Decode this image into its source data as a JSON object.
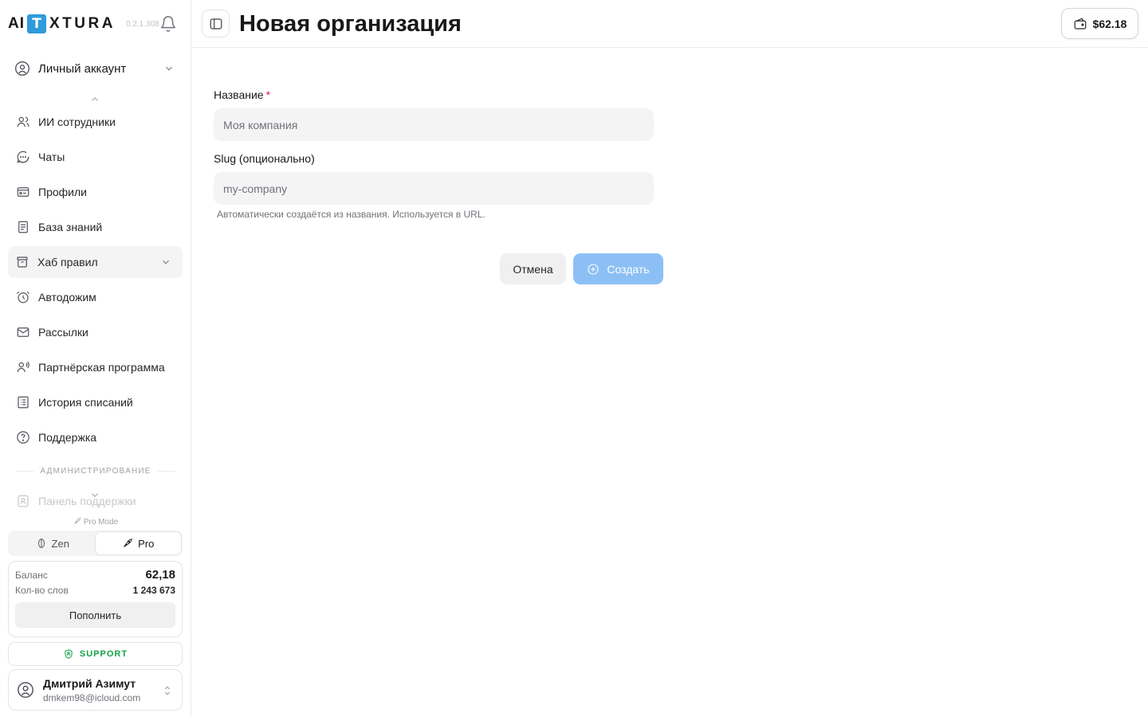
{
  "brand": {
    "prefix": "AI",
    "logo_letter": "T",
    "suffix": "XTURA",
    "version": "0.2.1.308"
  },
  "account": {
    "label": "Личный аккаунт"
  },
  "nav": [
    {
      "label": "ИИ сотрудники",
      "icon": "users-icon"
    },
    {
      "label": "Чаты",
      "icon": "chat-icon"
    },
    {
      "label": "Профили",
      "icon": "profile-card-icon"
    },
    {
      "label": "База знаний",
      "icon": "document-icon"
    },
    {
      "label": "Хаб правил",
      "icon": "rules-hub-icon"
    },
    {
      "label": "Автодожим",
      "icon": "alarm-clock-icon"
    },
    {
      "label": "Рассылки",
      "icon": "mail-icon"
    },
    {
      "label": "Партнёрская программа",
      "icon": "partner-icon"
    },
    {
      "label": "История списаний",
      "icon": "history-list-icon"
    },
    {
      "label": "Поддержка",
      "icon": "help-icon"
    }
  ],
  "admin": {
    "section": "АДМИНИСТРИРОВАНИЕ",
    "item": "Панель поддержки"
  },
  "mode": {
    "caption": "Pro Mode",
    "zen": "Zen",
    "pro": "Pro",
    "selected": "Pro"
  },
  "balance": {
    "balance_label": "Баланс",
    "balance_value": "62,18",
    "words_label": "Кол-во слов",
    "words_value": "1 243 673",
    "topup": "Пополнить"
  },
  "support": {
    "label": "SUPPORT"
  },
  "user": {
    "name": "Дмитрий Азимут",
    "email": "dmkem98@icloud.com"
  },
  "header": {
    "title": "Новая организация",
    "wallet": "$62.18"
  },
  "form": {
    "name_label": "Название",
    "required_mark": "*",
    "name_placeholder": "Моя компания",
    "slug_label": "Slug (опционально)",
    "slug_placeholder": "my-company",
    "slug_hint": "Автоматически создаётся из названия. Используется в URL.",
    "cancel": "Отмена",
    "create": "Создать"
  },
  "colors": {
    "accent": "#8cc0f5",
    "logo": "#2f9bdc",
    "support": "#16a34a",
    "required": "#e11d48"
  }
}
